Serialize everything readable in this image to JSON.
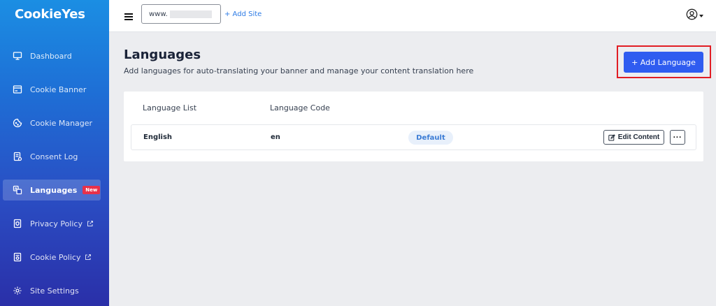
{
  "app": {
    "logo": "CookieYes"
  },
  "sidebar": {
    "items": [
      {
        "label": "Dashboard",
        "icon": "monitor-icon"
      },
      {
        "label": "Cookie Banner",
        "icon": "banner-icon"
      },
      {
        "label": "Cookie Manager",
        "icon": "cookie-icon"
      },
      {
        "label": "Consent Log",
        "icon": "log-icon"
      },
      {
        "label": "Languages",
        "icon": "translate-icon",
        "badge": "New",
        "active": true
      },
      {
        "label": "Privacy Policy",
        "icon": "shield-doc-icon",
        "external": true
      },
      {
        "label": "Cookie Policy",
        "icon": "cookie-doc-icon",
        "external": true
      },
      {
        "label": "Site Settings",
        "icon": "gear-icon"
      }
    ]
  },
  "topbar": {
    "site_prefix": "www.",
    "add_site": "+ Add Site"
  },
  "main": {
    "title": "Languages",
    "subtitle": "Add languages for auto-translating your banner and manage your content translation here",
    "add_language": "+ Add Language",
    "table": {
      "headers": [
        "Language List",
        "Language Code"
      ],
      "rows": [
        {
          "language": "English",
          "code": "en",
          "status": "Default",
          "edit_label": "Edit Content",
          "more": "···"
        }
      ]
    }
  },
  "colors": {
    "accent": "#2f5cf0",
    "highlight": "#e11d24",
    "badge": "#e8314a"
  }
}
